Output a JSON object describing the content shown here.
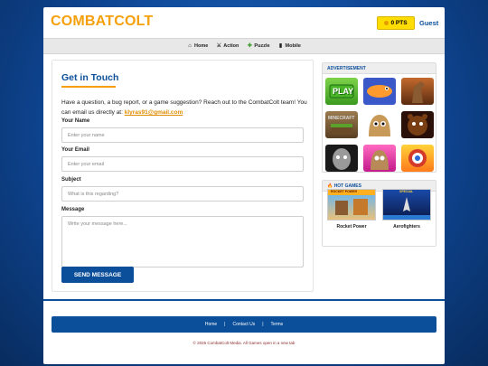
{
  "header": {
    "logo": "COMBATCOLT",
    "points": "0 PTS",
    "user": "Guest"
  },
  "nav": {
    "items": [
      {
        "label": "Home",
        "icon": "home-icon"
      },
      {
        "label": "Action",
        "icon": "swords-icon"
      },
      {
        "label": "Puzzle",
        "icon": "puzzle-icon"
      },
      {
        "label": "Mobile",
        "icon": "mobile-icon"
      }
    ]
  },
  "contact": {
    "title": "Get in Touch",
    "intro": "Have a question, a bug report, or a game suggestion? Reach out to the CombatColt team! You can email us directly at: ",
    "email": "klyras91@gmail.com",
    "name_label": "Your Name",
    "name_placeholder": "Enter your name",
    "email_label": "Your Email",
    "email_placeholder": "Enter your email",
    "subject_label": "Subject",
    "subject_placeholder": "What is this regarding?",
    "message_label": "Message",
    "message_placeholder": "Write your message here...",
    "send_label": "SEND MESSAGE"
  },
  "sidebar": {
    "ad_title": "ADVERTISEMENT",
    "ad_tiles": [
      {
        "name": "play-game-tile",
        "text": "PLAY"
      },
      {
        "name": "snake-game-tile",
        "text": ""
      },
      {
        "name": "horse-game-tile",
        "text": ""
      },
      {
        "name": "minecraft-game-tile",
        "text": "MINECRAFT"
      },
      {
        "name": "pou-game-tile",
        "text": ""
      },
      {
        "name": "freddy-game-tile",
        "text": ""
      },
      {
        "name": "granny-game-tile",
        "text": ""
      },
      {
        "name": "pou-pink-game-tile",
        "text": ""
      },
      {
        "name": "subway-game-tile",
        "text": ""
      }
    ],
    "hot_title": "HOT GAMES",
    "hot_games": [
      {
        "name": "Rocket Power",
        "banner": "ROCKET POWER"
      },
      {
        "name": "Aerofighters",
        "banner": "SPECIAL"
      }
    ]
  },
  "footer": {
    "links": [
      "Home",
      "Contact Us",
      "Terms"
    ],
    "separator": "|",
    "copyright": "© 2026 CombatColt Media. All Games open in a new tab"
  },
  "colors": {
    "accent": "#f5a00b",
    "brand": "#0b4e9a",
    "background": "#0d3f86"
  }
}
